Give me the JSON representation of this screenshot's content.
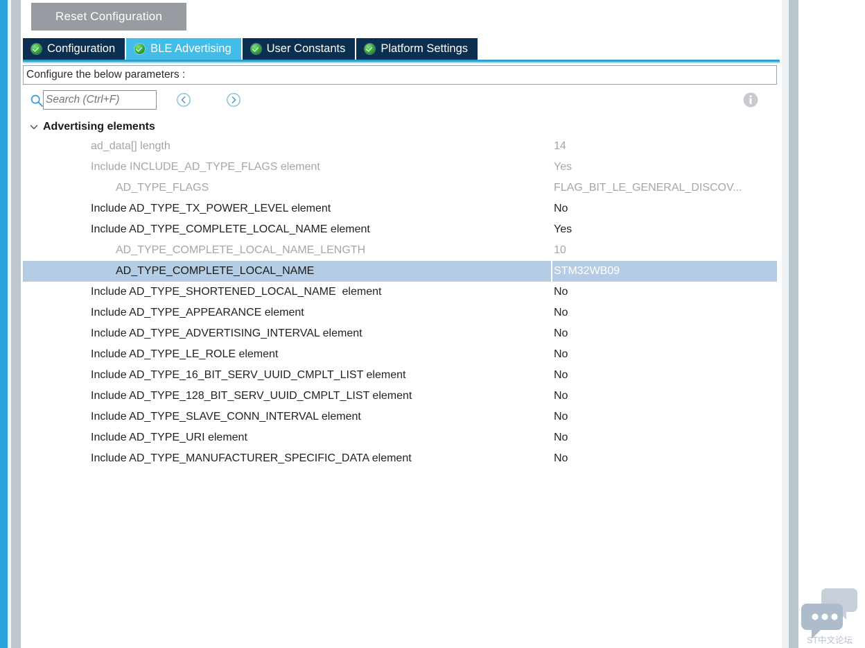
{
  "toolbar": {
    "reset_label": "Reset Configuration"
  },
  "tabs": [
    {
      "label": "Configuration",
      "icon": "green-check-icon",
      "active": false
    },
    {
      "label": "BLE Advertising",
      "icon": "green-check-icon",
      "active": true
    },
    {
      "label": "User Constants",
      "icon": "green-check-icon",
      "active": false
    },
    {
      "label": "Platform Settings",
      "icon": "green-check-icon",
      "active": false
    }
  ],
  "header": {
    "text": "Configure the below parameters :"
  },
  "search": {
    "placeholder": "Search (Ctrl+F)",
    "value": "",
    "icon": "search-icon",
    "prev_icon": "circle-chevron-left-icon",
    "next_icon": "circle-chevron-right-icon",
    "info_icon": "info-icon"
  },
  "tree": {
    "group": {
      "label": "Advertising elements",
      "expanded": true,
      "chevron": "chevron-down-icon"
    },
    "rows": [
      {
        "name": "ad_data[] length",
        "value": "14",
        "level": 1,
        "state": "disabled",
        "selected": false
      },
      {
        "name": "Include INCLUDE_AD_TYPE_FLAGS element",
        "value": "Yes",
        "level": 1,
        "state": "disabled",
        "selected": false
      },
      {
        "name": "AD_TYPE_FLAGS",
        "value": "FLAG_BIT_LE_GENERAL_DISCOV...",
        "level": 2,
        "state": "disabled",
        "selected": false
      },
      {
        "name": "Include AD_TYPE_TX_POWER_LEVEL element",
        "value": "No",
        "level": 1,
        "state": "enabled",
        "selected": false
      },
      {
        "name": "Include AD_TYPE_COMPLETE_LOCAL_NAME element",
        "value": "Yes",
        "level": 1,
        "state": "enabled",
        "selected": false
      },
      {
        "name": "AD_TYPE_COMPLETE_LOCAL_NAME_LENGTH",
        "value": "10",
        "level": 2,
        "state": "disabled",
        "selected": false
      },
      {
        "name": "AD_TYPE_COMPLETE_LOCAL_NAME",
        "value": "STM32WB09",
        "level": 2,
        "state": "enabled",
        "selected": true
      },
      {
        "name": "Include AD_TYPE_SHORTENED_LOCAL_NAME  element",
        "value": "No",
        "level": 1,
        "state": "enabled",
        "selected": false
      },
      {
        "name": "Include AD_TYPE_APPEARANCE element",
        "value": "No",
        "level": 1,
        "state": "enabled",
        "selected": false
      },
      {
        "name": "Include AD_TYPE_ADVERTISING_INTERVAL element",
        "value": "No",
        "level": 1,
        "state": "enabled",
        "selected": false
      },
      {
        "name": "Include AD_TYPE_LE_ROLE element",
        "value": "No",
        "level": 1,
        "state": "enabled",
        "selected": false
      },
      {
        "name": "Include AD_TYPE_16_BIT_SERV_UUID_CMPLT_LIST element",
        "value": "No",
        "level": 1,
        "state": "enabled",
        "selected": false
      },
      {
        "name": "Include AD_TYPE_128_BIT_SERV_UUID_CMPLT_LIST element",
        "value": "No",
        "level": 1,
        "state": "enabled",
        "selected": false
      },
      {
        "name": "Include AD_TYPE_SLAVE_CONN_INTERVAL element",
        "value": "No",
        "level": 1,
        "state": "enabled",
        "selected": false
      },
      {
        "name": "Include AD_TYPE_URI element",
        "value": "No",
        "level": 1,
        "state": "enabled",
        "selected": false
      },
      {
        "name": "Include AD_TYPE_MANUFACTURER_SPECIFIC_DATA element",
        "value": "No",
        "level": 1,
        "state": "enabled",
        "selected": false
      }
    ]
  },
  "watermark": {
    "label": "ST中文论坛",
    "icon": "chat-bubbles-icon"
  },
  "colors": {
    "accent_blue": "#29a3dc",
    "tab_active": "#41bde8",
    "tab_inactive": "#0b2f51",
    "selection": "#b4cde4",
    "disabled_text": "#a6a6a6",
    "button_gray": "#969ca2"
  }
}
